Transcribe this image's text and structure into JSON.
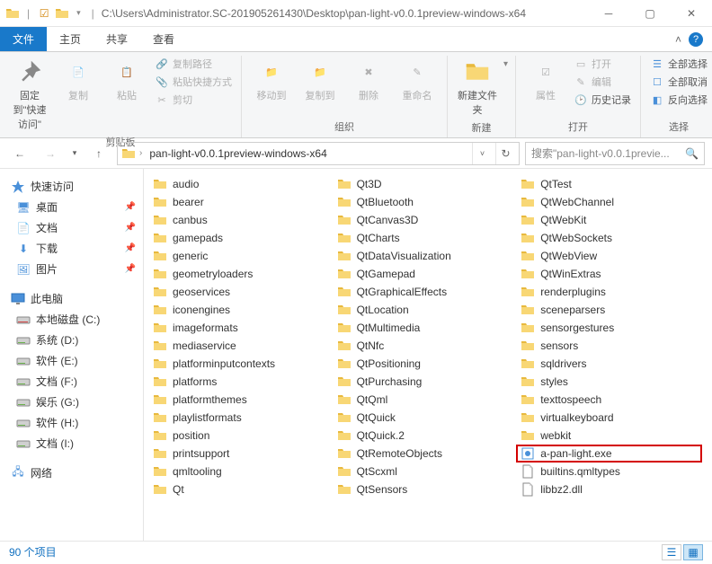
{
  "titlebar": {
    "path": "C:\\Users\\Administrator.SC-201905261430\\Desktop\\pan-light-v0.0.1preview-windows-x64"
  },
  "tabs": {
    "file": "文件",
    "home": "主页",
    "share": "共享",
    "view": "查看"
  },
  "ribbon": {
    "pin": "固定到\"快速访问\"",
    "copy": "复制",
    "paste": "粘贴",
    "copy_path": "复制路径",
    "paste_shortcut": "粘贴快捷方式",
    "cut": "剪切",
    "clipboard_group": "剪贴板",
    "move_to": "移动到",
    "copy_to": "复制到",
    "delete": "删除",
    "rename": "重命名",
    "organize_group": "组织",
    "new_folder": "新建文件夹",
    "new_group": "新建",
    "properties": "属性",
    "open": "打开",
    "edit": "编辑",
    "history": "历史记录",
    "open_group": "打开",
    "select_all": "全部选择",
    "select_none": "全部取消",
    "invert": "反向选择",
    "select_group": "选择"
  },
  "address": {
    "crumb": "pan-light-v0.0.1preview-windows-x64",
    "search_placeholder": "搜索\"pan-light-v0.0.1previe..."
  },
  "sidebar": {
    "quick_access": "快速访问",
    "desktop": "桌面",
    "documents": "文档",
    "downloads": "下载",
    "pictures": "图片",
    "this_pc": "此电脑",
    "local_c": "本地磁盘 (C:)",
    "system_d": "系统 (D:)",
    "soft_e": "软件 (E:)",
    "doc_f": "文档 (F:)",
    "ent_g": "娱乐 (G:)",
    "soft_h": "软件 (H:)",
    "doc_i": "文档 (I:)",
    "network": "网络"
  },
  "files": {
    "col1": [
      "audio",
      "bearer",
      "canbus",
      "gamepads",
      "generic",
      "geometryloaders",
      "geoservices",
      "iconengines",
      "imageformats",
      "mediaservice",
      "platforminputcontexts",
      "platforms",
      "platformthemes",
      "playlistformats",
      "position",
      "printsupport",
      "qmltooling",
      "Qt"
    ],
    "col2": [
      "Qt3D",
      "QtBluetooth",
      "QtCanvas3D",
      "QtCharts",
      "QtDataVisualization",
      "QtGamepad",
      "QtGraphicalEffects",
      "QtLocation",
      "QtMultimedia",
      "QtNfc",
      "QtPositioning",
      "QtPurchasing",
      "QtQml",
      "QtQuick",
      "QtQuick.2",
      "QtRemoteObjects",
      "QtScxml",
      "QtSensors"
    ],
    "col3_folders": [
      "QtTest",
      "QtWebChannel",
      "QtWebKit",
      "QtWebSockets",
      "QtWebView",
      "QtWinExtras",
      "renderplugins",
      "sceneparsers",
      "sensorgestures",
      "sensors",
      "sqldrivers",
      "styles",
      "texttospeech",
      "virtualkeyboard",
      "webkit"
    ],
    "exe": "a-pan-light.exe",
    "qmltypes": "builtins.qmltypes",
    "dll": "libbz2.dll"
  },
  "status": {
    "count": "90 个项目"
  }
}
